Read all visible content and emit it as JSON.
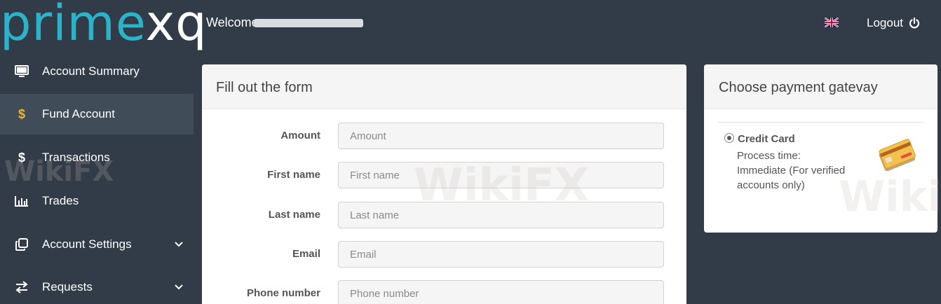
{
  "brand": {
    "logo_main": "prime",
    "logo_accent": "xq",
    "logo_color": "#2bb4c9"
  },
  "header": {
    "welcome": "Welcome",
    "language_icon": "uk-flag-icon",
    "logout_label": "Logout",
    "logout_icon": "power-icon"
  },
  "sidebar": {
    "items": [
      {
        "label": "Account Summary",
        "icon": "monitor-icon",
        "active": false
      },
      {
        "label": "Fund Account",
        "icon": "dollar-icon",
        "active": true
      },
      {
        "label": "Transactions",
        "icon": "dollar-icon",
        "active": false
      },
      {
        "label": "Trades",
        "icon": "bar-chart-icon",
        "active": false
      },
      {
        "label": "Account Settings",
        "icon": "copy-icon",
        "active": false,
        "expandable": true
      },
      {
        "label": "Requests",
        "icon": "exchange-icon",
        "active": false,
        "expandable": true
      }
    ]
  },
  "form": {
    "title": "Fill out the form",
    "fields": [
      {
        "label": "Amount",
        "placeholder": "Amount",
        "value": ""
      },
      {
        "label": "First name",
        "placeholder": "First name",
        "value": ""
      },
      {
        "label": "Last name",
        "placeholder": "Last name",
        "value": ""
      },
      {
        "label": "Email",
        "placeholder": "Email",
        "value": ""
      },
      {
        "label": "Phone number",
        "placeholder": "Phone number",
        "value": ""
      }
    ]
  },
  "payment": {
    "title": "Choose payment gatevay",
    "option": {
      "name": "Credit Card",
      "selected": true,
      "line1": "Process time:",
      "line2": "Immediate (For verified accounts only)",
      "icon": "credit-card-icon"
    }
  },
  "colors": {
    "background": "#323c48",
    "active_item": "#414c59",
    "dollar_active": "#f0b428"
  },
  "watermark": "WikiFX"
}
